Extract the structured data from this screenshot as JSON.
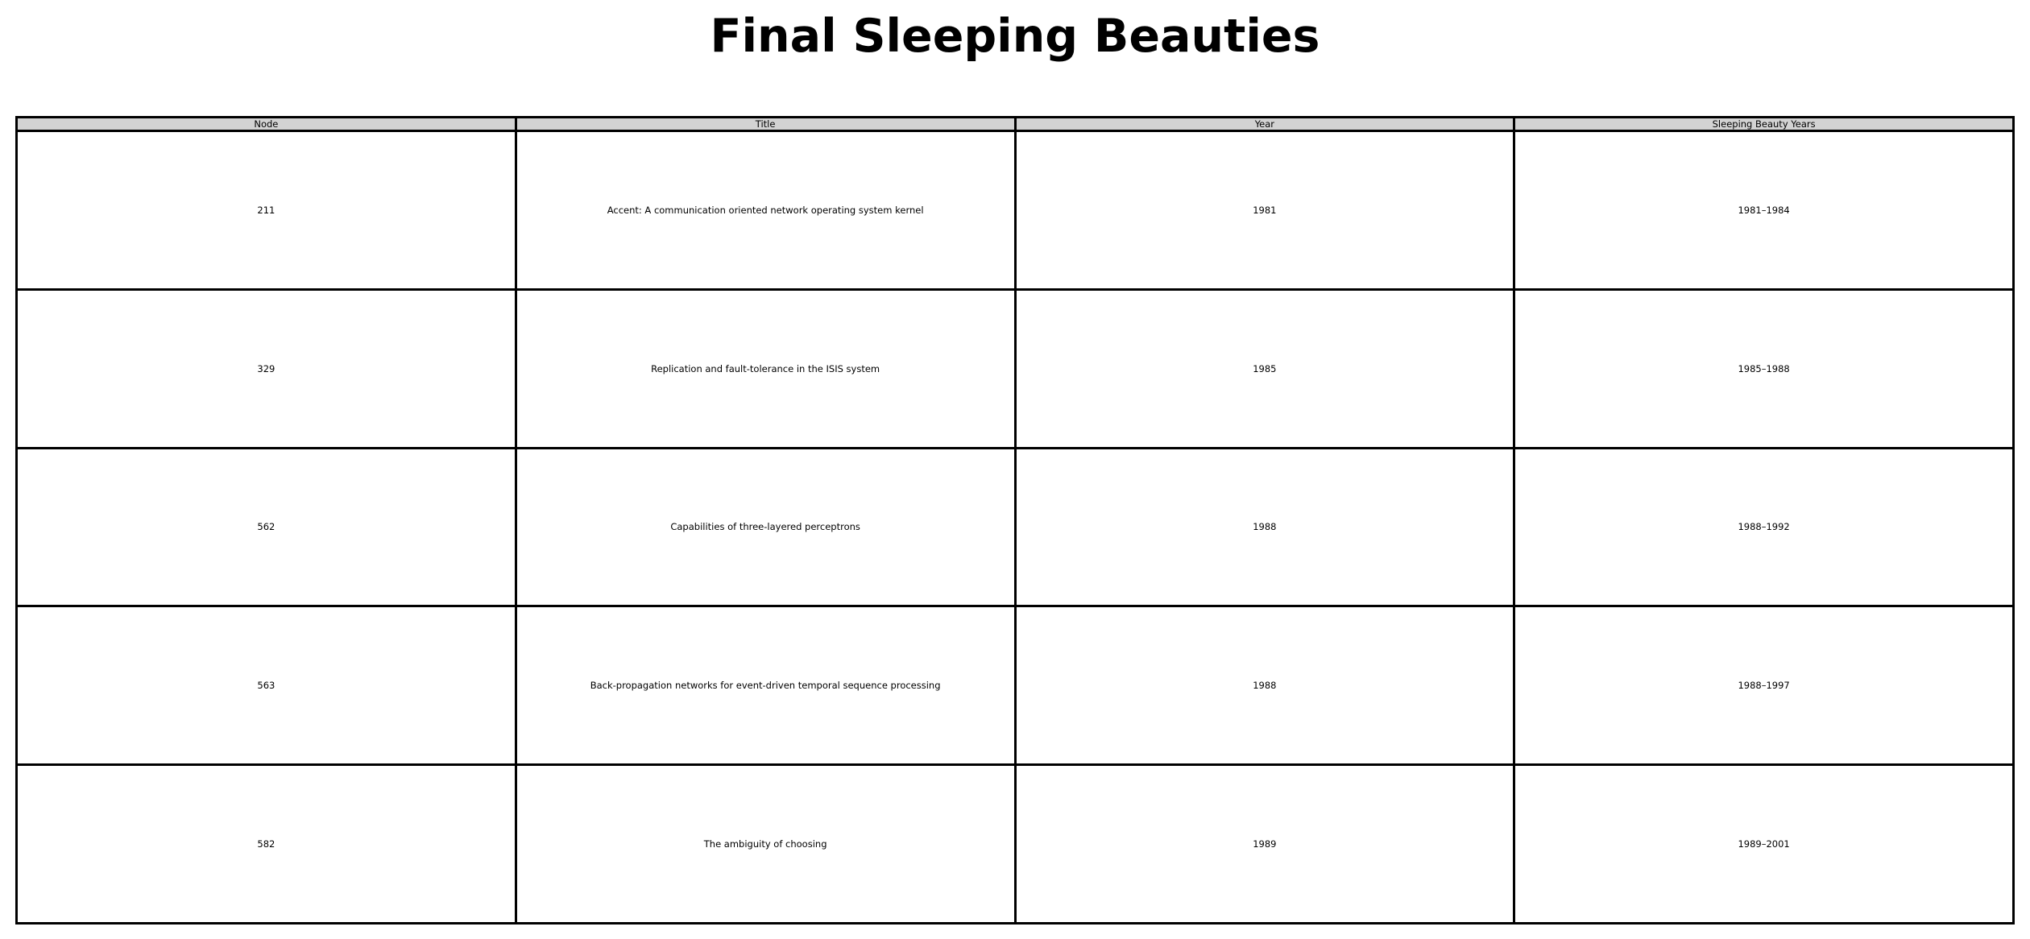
{
  "chart_data": {
    "type": "table",
    "title": "Final Sleeping Beauties",
    "columns": [
      "Node",
      "Title",
      "Year",
      "Sleeping Beauty Years"
    ],
    "rows": [
      [
        "211",
        "Accent: A communication oriented network operating system kernel",
        "1981",
        "1981–1984"
      ],
      [
        "329",
        "Replication and fault-tolerance in the ISIS system",
        "1985",
        "1985–1988"
      ],
      [
        "562",
        "Capabilities of three-layered perceptrons",
        "1988",
        "1988–1992"
      ],
      [
        "563",
        "Back-propagation networks for event-driven temporal sequence processing",
        "1988",
        "1988–1997"
      ],
      [
        "582",
        "The ambiguity of choosing",
        "1989",
        "1989–2001"
      ]
    ],
    "colors": {
      "header_background": "#d3d3d3",
      "cell_background": "#ffffff",
      "border": "#000000"
    }
  }
}
